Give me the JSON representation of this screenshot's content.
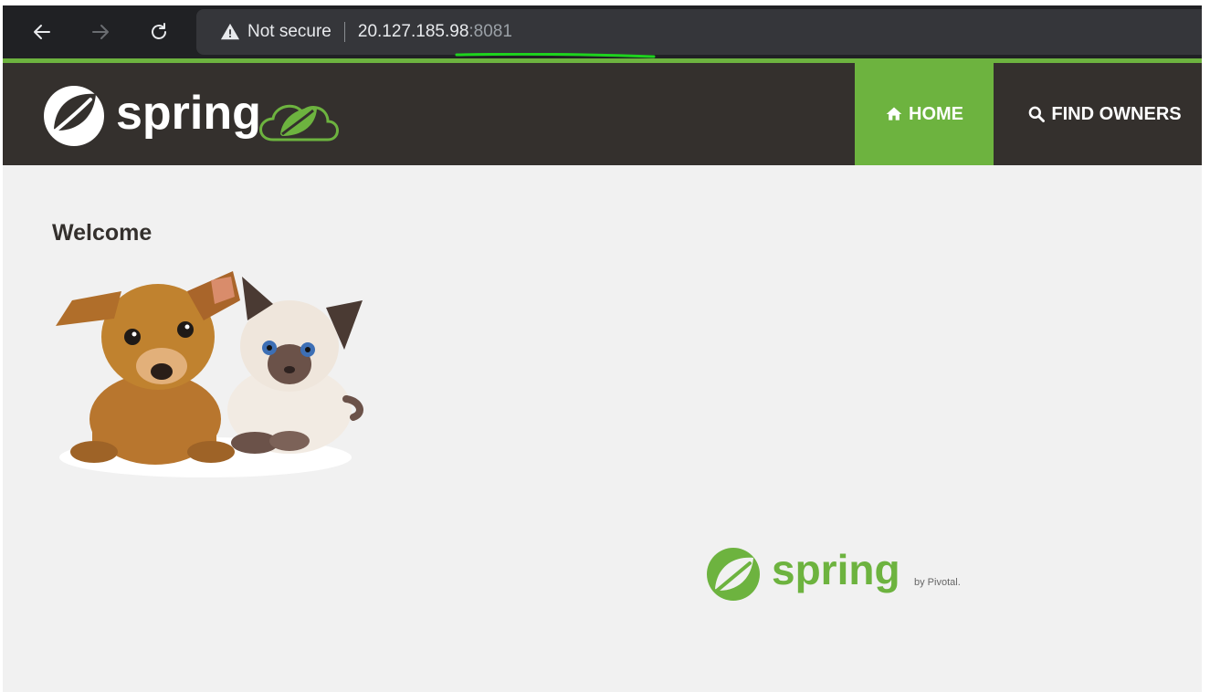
{
  "browser": {
    "security_label": "Not secure",
    "url_host": "20.127.185.98",
    "url_port": ":8081",
    "icons": [
      "back-arrow-icon",
      "forward-arrow-icon",
      "reload-icon",
      "warning-icon"
    ]
  },
  "navbar": {
    "brand_text": "spring",
    "home_label": "HOME",
    "find_owners_label": "FIND OWNERS",
    "icons": [
      "home-icon",
      "search-icon"
    ]
  },
  "main": {
    "heading": "Welcome",
    "image_alt": "puppy-and-kitten"
  },
  "footer": {
    "brand_text": "spring",
    "byline": "by Pivotal."
  },
  "colors": {
    "brand_green": "#6db33f",
    "navbar_bg": "#34302d",
    "content_bg": "#f1f1f1",
    "chrome_bg": "#202124"
  }
}
